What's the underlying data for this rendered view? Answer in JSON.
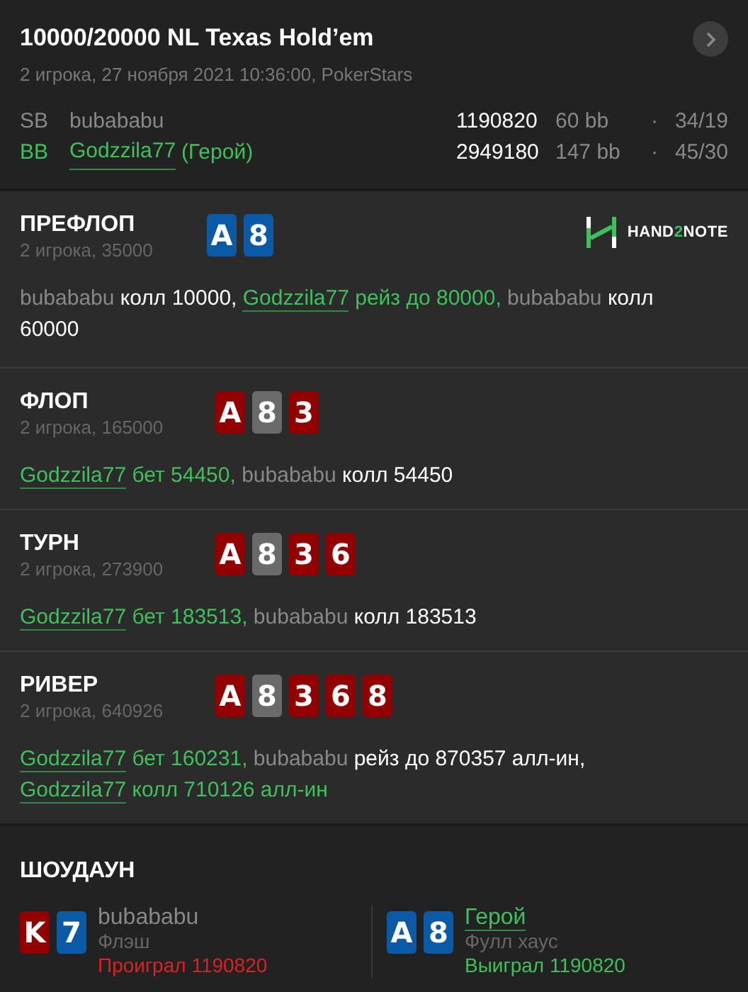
{
  "header": {
    "title": "10000/20000 NL Texas Hold’em",
    "subtitle": "2 игрока, 27 ноября 2021 10:36:00, PokerStars",
    "players": [
      {
        "position": "SB",
        "name": "bubababu",
        "hero": false,
        "stack": "1190820",
        "bb": "60 bb",
        "dot": "·",
        "stats": "34/19"
      },
      {
        "position": "BB",
        "name": "Godzzila77",
        "hero": true,
        "hero_tag": "(Герой)",
        "stack": "2949180",
        "bb": "147 bb",
        "dot": "·",
        "stats": "45/30"
      }
    ]
  },
  "logo": {
    "before": "HAND",
    "accent": "2",
    "after": "NOTE"
  },
  "streets": [
    {
      "title": "ПРЕФЛОП",
      "info": "2 игрока, 35000",
      "cards": [
        {
          "rank": "A",
          "color": "#0a5aa8"
        },
        {
          "rank": "8",
          "color": "#0a5aa8"
        }
      ],
      "actions": [
        {
          "player": "bubababu",
          "hero": false,
          "text": "колл 10000,"
        },
        {
          "player": "Godzzila77",
          "hero": true,
          "text": "рейз до 80000,"
        },
        {
          "player": "bubababu",
          "hero": false,
          "text": "колл 60000"
        }
      ]
    },
    {
      "title": "ФЛОП",
      "info": "2 игрока, 165000",
      "cards": [
        {
          "rank": "A",
          "color": "#920000"
        },
        {
          "rank": "8",
          "color": "#6a6a6a"
        },
        {
          "rank": "3",
          "color": "#920000"
        }
      ],
      "actions": [
        {
          "player": "Godzzila77",
          "hero": true,
          "text": "бет 54450,"
        },
        {
          "player": "bubababu",
          "hero": false,
          "text": "колл 54450"
        }
      ]
    },
    {
      "title": "ТУРН",
      "info": "2 игрока, 273900",
      "cards": [
        {
          "rank": "A",
          "color": "#920000"
        },
        {
          "rank": "8",
          "color": "#6a6a6a"
        },
        {
          "rank": "3",
          "color": "#920000"
        },
        {
          "rank": "6",
          "color": "#920000"
        }
      ],
      "actions": [
        {
          "player": "Godzzila77",
          "hero": true,
          "text": "бет 183513,"
        },
        {
          "player": "bubababu",
          "hero": false,
          "text": "колл 183513"
        }
      ]
    },
    {
      "title": "РИВЕР",
      "info": "2 игрока, 640926",
      "cards": [
        {
          "rank": "A",
          "color": "#920000"
        },
        {
          "rank": "8",
          "color": "#6a6a6a"
        },
        {
          "rank": "3",
          "color": "#920000"
        },
        {
          "rank": "6",
          "color": "#920000"
        },
        {
          "rank": "8",
          "color": "#920000"
        }
      ],
      "actions": [
        {
          "player": "Godzzila77",
          "hero": true,
          "text": "бет 160231,"
        },
        {
          "player": "bubababu",
          "hero": false,
          "text": "рейз до 870357 алл-ин,"
        },
        {
          "player": "Godzzila77",
          "hero": true,
          "text": "колл 710126 алл-ин"
        }
      ]
    }
  ],
  "showdown": {
    "title": "ШОУДАУН",
    "hands": [
      {
        "name": "bubababu",
        "hero": false,
        "won": false,
        "hand": "Флэш",
        "result": "Проиграл 1190820",
        "cards": [
          {
            "rank": "K",
            "color": "#920000"
          },
          {
            "rank": "7",
            "color": "#0a5aa8"
          }
        ]
      },
      {
        "name": "Герой",
        "hero": true,
        "won": true,
        "hand": "Фулл хаус",
        "result": "Выиграл 1190820",
        "cards": [
          {
            "rank": "A",
            "color": "#0a5aa8"
          },
          {
            "rank": "8",
            "color": "#0a5aa8"
          }
        ]
      }
    ]
  }
}
